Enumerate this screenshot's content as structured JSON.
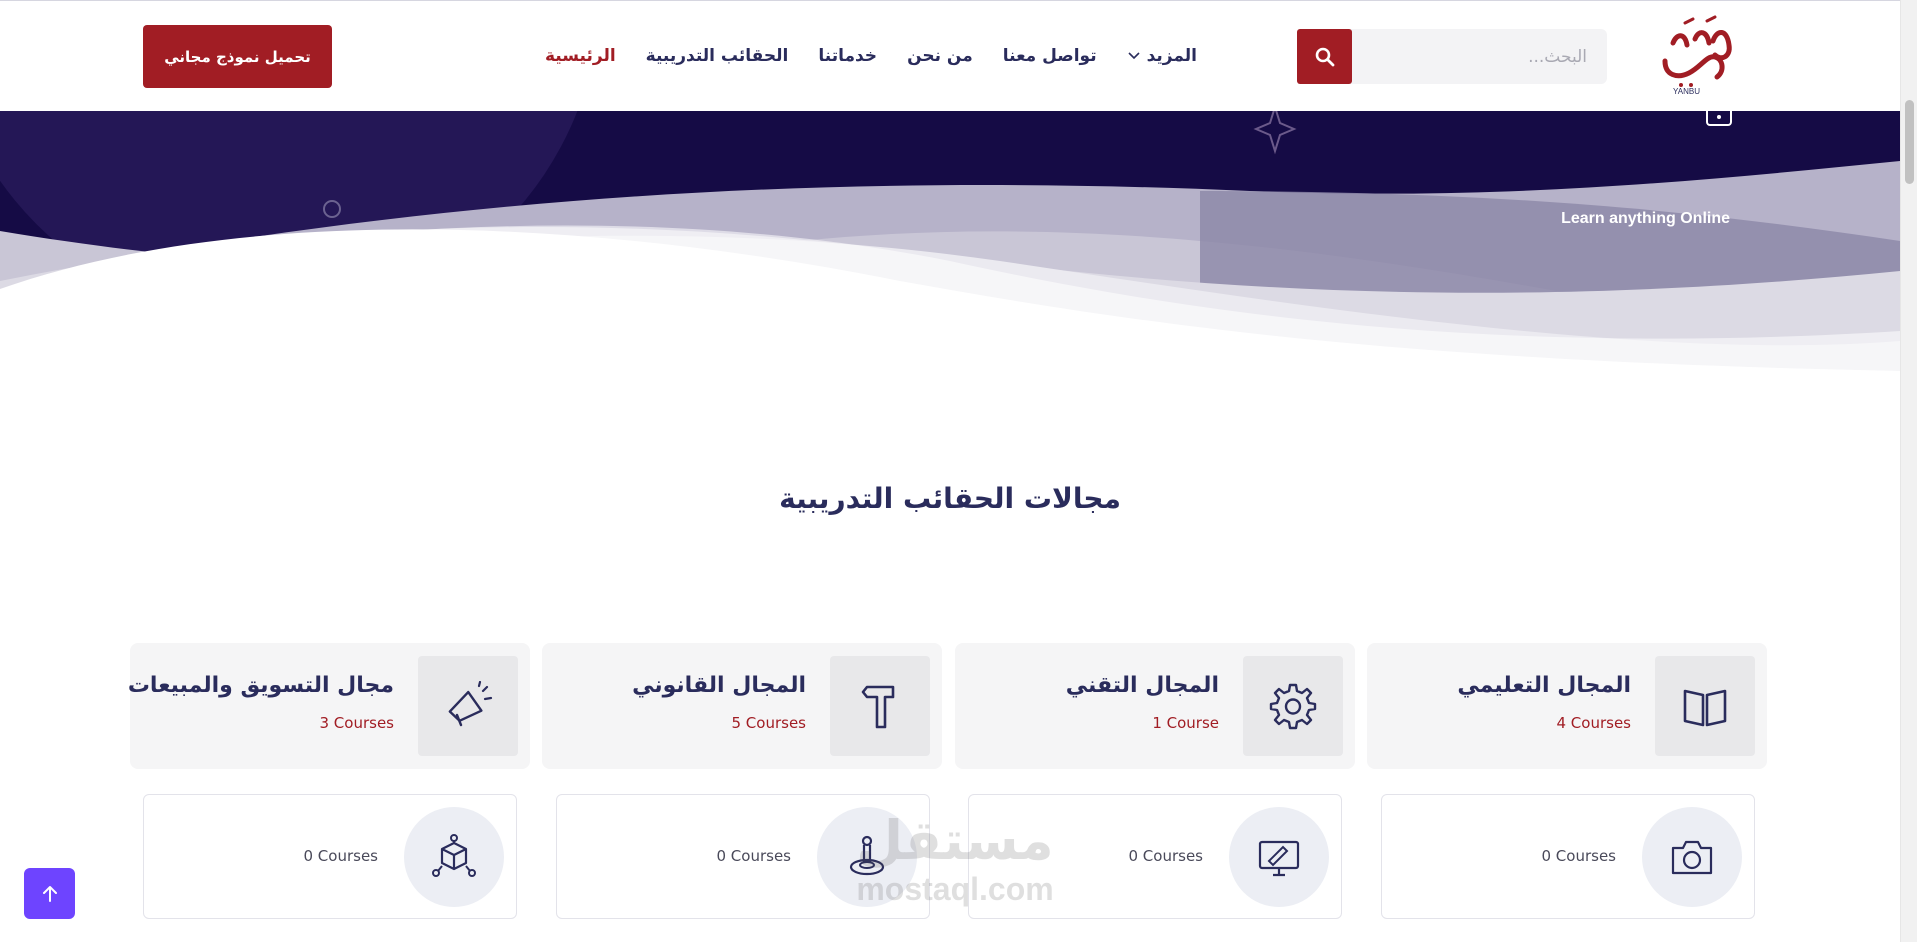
{
  "header": {
    "logo_text": "YANBU",
    "search": {
      "placeholder": "البحث..."
    },
    "nav": [
      {
        "label": "الرئيسية",
        "active": true
      },
      {
        "label": "الحقائب التدريبية"
      },
      {
        "label": "خدماتنا"
      },
      {
        "label": "من نحن"
      },
      {
        "label": "تواصل معنا"
      },
      {
        "label": "المزيد"
      }
    ],
    "cta_label": "تحميل نموذج مجاني"
  },
  "hero": {
    "tagline": "Learn anything Online"
  },
  "section": {
    "title": "مجالات الحقائب التدريبية"
  },
  "categories": [
    {
      "title": "المجال التعليمي",
      "count": "4 Courses",
      "icon": "book-icon"
    },
    {
      "title": "المجال التقني",
      "count": "1 Course",
      "icon": "gear-icon"
    },
    {
      "title": "المجال القانوني",
      "count": "5 Courses",
      "icon": "hammer-icon"
    },
    {
      "title": "مجال التسويق والمبيعات",
      "count": "3 Courses",
      "icon": "megaphone-icon"
    }
  ],
  "subcategories": [
    {
      "count": "0 Courses",
      "icon": "camera-icon"
    },
    {
      "count": "0 Courses",
      "icon": "design-monitor-icon"
    },
    {
      "count": "0 Courses",
      "icon": "joystick-icon"
    },
    {
      "count": "0 Courses",
      "icon": "3d-cube-icon"
    }
  ],
  "watermark": {
    "arabic": "مستقل",
    "latin": "mostaql.com"
  },
  "colors": {
    "brand_red": "#a11d24",
    "navy": "#2a2c5c",
    "hero_bg": "#150b45",
    "to_top": "#6e44ff"
  }
}
